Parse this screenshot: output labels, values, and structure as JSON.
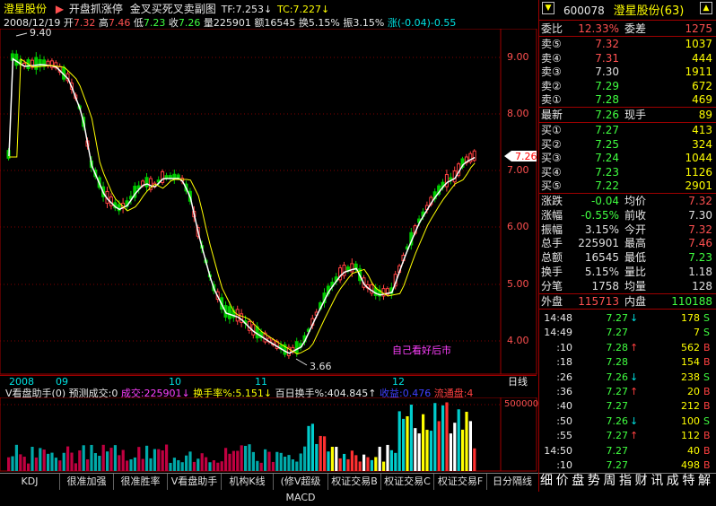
{
  "header": {
    "stock_name": "澄星股份",
    "arrow": "▶",
    "indicator": "开盘抓涨停",
    "signal": "金叉买死叉卖副图",
    "tf": "TF:7.253↓",
    "tc": "TC:7.227↓"
  },
  "info_line": {
    "date": "2008/12/19",
    "open_label": "开",
    "open": "7.32",
    "high_label": "高",
    "high": "7.46",
    "low_label": "低",
    "low": "7.23",
    "close_label": "收",
    "close": "7.26",
    "vol_label": "量",
    "vol": "225901",
    "amt_label": "额",
    "amt": "16545",
    "turn_label": "换",
    "turn": "5.15%",
    "amp_label": "振",
    "amp": "3.15%",
    "chg_label": "涨",
    "chg": "(-0.04)-0.55"
  },
  "price_axis": [
    "9.00",
    "8.00",
    "7.00",
    "6.00",
    "5.00",
    "4.00"
  ],
  "current_price_tag": "7.26",
  "max_label": "9.40",
  "min_label": "3.66",
  "annotation": "自己看好后市",
  "date_axis": [
    "2008",
    "09",
    "10",
    "11",
    "12"
  ],
  "period_label": "日线",
  "volume_header": {
    "title": "V看盘助手(0)",
    "pred": "预测成交:0",
    "vol": "成交:225901↓",
    "turn": "换手率%:5.151↓",
    "avg": "百日换手%:404.845↑",
    "profit": "收益:0.476",
    "float": "流通盘:4"
  },
  "volume_axis": "500000",
  "bottom_tabs": [
    "KDJ",
    "很准加强",
    "很准胜率",
    "V看盘助手",
    "机构K线",
    "(修V超级MACD",
    "权证交易B",
    "权证交易C",
    "权证交易F",
    "日分隔线"
  ],
  "bottom_menu": [
    "细",
    "价",
    "盘",
    "势",
    "周",
    "指",
    "财",
    "讯",
    "成",
    "特",
    "解"
  ],
  "quote": {
    "code": "600078",
    "name": "澄星股份(63)",
    "webi_label": "委比",
    "webi": "12.33%",
    "weicha_label": "委差",
    "weicha": "1275",
    "asks": [
      {
        "label": "卖⑤",
        "price": "7.32",
        "vol": "1037"
      },
      {
        "label": "卖④",
        "price": "7.31",
        "vol": "444"
      },
      {
        "label": "卖③",
        "price": "7.30",
        "vol": "1911"
      },
      {
        "label": "卖②",
        "price": "7.29",
        "vol": "672"
      },
      {
        "label": "卖①",
        "price": "7.28",
        "vol": "469"
      }
    ],
    "last_label": "最新",
    "last": "7.26",
    "now_label": "现手",
    "now": "89",
    "bids": [
      {
        "label": "买①",
        "price": "7.27",
        "vol": "413"
      },
      {
        "label": "买②",
        "price": "7.25",
        "vol": "324"
      },
      {
        "label": "买③",
        "price": "7.24",
        "vol": "1044"
      },
      {
        "label": "买④",
        "price": "7.23",
        "vol": "1126"
      },
      {
        "label": "买⑤",
        "price": "7.22",
        "vol": "2901"
      }
    ],
    "stats": [
      {
        "l1": "涨跌",
        "v1": "-0.04",
        "l2": "均价",
        "v2": "7.32"
      },
      {
        "l1": "涨幅",
        "v1": "-0.55%",
        "l2": "前收",
        "v2": "7.30"
      },
      {
        "l1": "振幅",
        "v1": "3.15%",
        "l2": "今开",
        "v2": "7.32"
      },
      {
        "l1": "总手",
        "v1": "225901",
        "l2": "最高",
        "v2": "7.46"
      },
      {
        "l1": "总额",
        "v1": "16545",
        "l2": "最低",
        "v2": "7.23"
      },
      {
        "l1": "换手",
        "v1": "5.15%",
        "l2": "量比",
        "v2": "1.18"
      },
      {
        "l1": "分笔",
        "v1": "1758",
        "l2": "均量",
        "v2": "128"
      }
    ],
    "outer_label": "外盘",
    "outer": "115713",
    "inner_label": "内盘",
    "inner": "110188"
  },
  "ticks": [
    {
      "time": "14:48",
      "price": "7.27",
      "arrow": "↓",
      "vol": "178",
      "side": "S"
    },
    {
      "time": "14:49",
      "price": "7.27",
      "arrow": "",
      "vol": "7",
      "side": "S"
    },
    {
      "time": ":10",
      "price": "7.28",
      "arrow": "↑",
      "vol": "562",
      "side": "B"
    },
    {
      "time": ":18",
      "price": "7.28",
      "arrow": "",
      "vol": "154",
      "side": "B"
    },
    {
      "time": ":26",
      "price": "7.26",
      "arrow": "↓",
      "vol": "238",
      "side": "S"
    },
    {
      "time": ":36",
      "price": "7.27",
      "arrow": "↑",
      "vol": "20",
      "side": "B"
    },
    {
      "time": ":40",
      "price": "7.27",
      "arrow": "",
      "vol": "212",
      "side": "B"
    },
    {
      "time": ":50",
      "price": "7.26",
      "arrow": "↓",
      "vol": "100",
      "side": "S"
    },
    {
      "time": ":55",
      "price": "7.27",
      "arrow": "↑",
      "vol": "112",
      "side": "B"
    },
    {
      "time": "14:50",
      "price": "7.27",
      "arrow": "",
      "vol": "40",
      "side": "B"
    },
    {
      "time": ":10",
      "price": "7.27",
      "arrow": "",
      "vol": "498",
      "side": "B"
    }
  ],
  "colors": {
    "up": "#ff4040",
    "down": "#00cc00",
    "grid": "#a00000",
    "ma_white": "#ffffff",
    "ma_yellow": "#ffff00"
  }
}
